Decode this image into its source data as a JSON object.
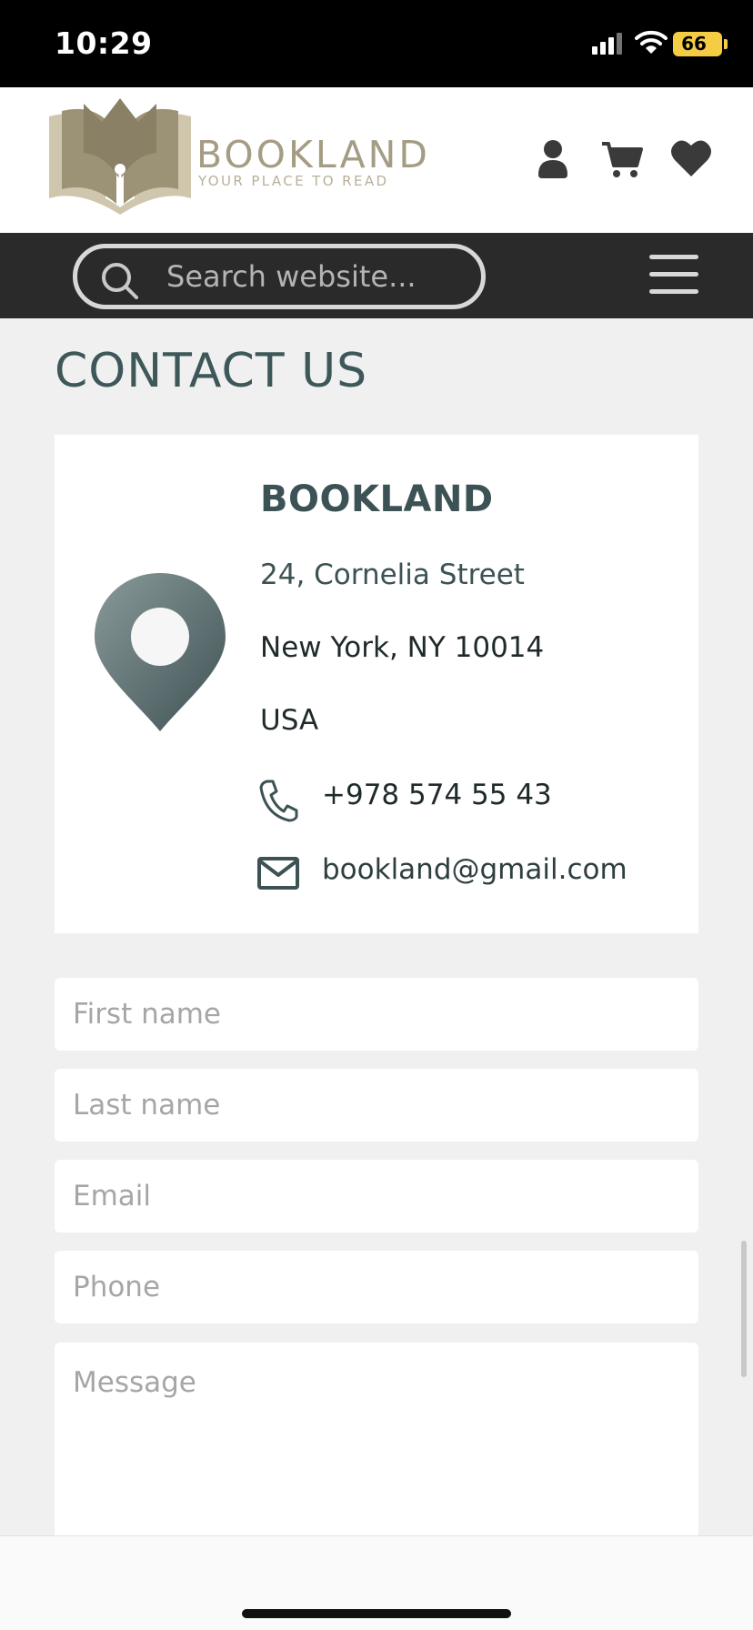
{
  "status_bar": {
    "time": "10:29",
    "battery": "66"
  },
  "header": {
    "brand": "BOOKLAND",
    "tagline": "YOUR PLACE TO READ"
  },
  "search": {
    "placeholder": "Search website..."
  },
  "contact": {
    "title": "CONTACT US",
    "company": "BOOKLAND",
    "address_line1": "24, Cornelia Street",
    "address_line2": "New York, NY 10014",
    "country": "USA",
    "phone": "+978 574 55 43",
    "email": "bookland@gmail.com"
  },
  "form": {
    "first_name_placeholder": "First name",
    "last_name_placeholder": "Last name",
    "email_placeholder": "Email",
    "phone_placeholder": "Phone",
    "message_placeholder": "Message"
  },
  "colors": {
    "accent": "#3d5254",
    "brand_gold": "#a59c84",
    "navbar": "#2b2a2b"
  }
}
